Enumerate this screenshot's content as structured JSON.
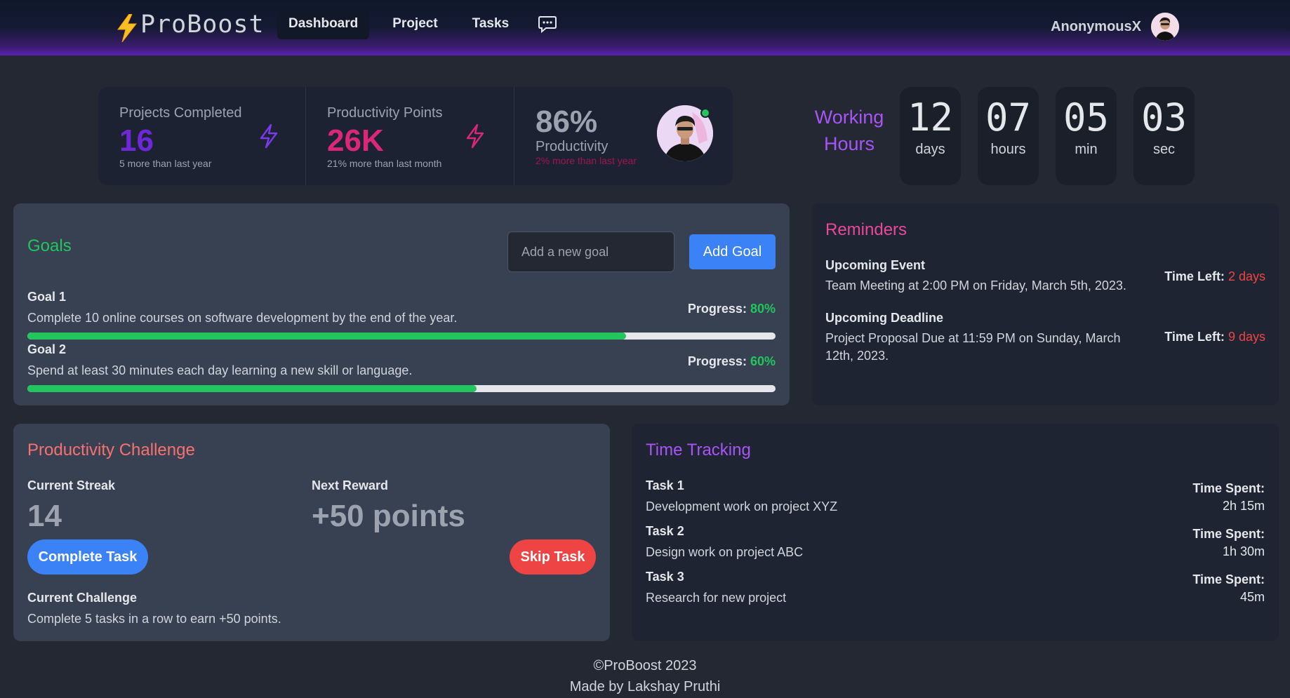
{
  "brand": {
    "name": "ProBoost"
  },
  "nav": {
    "items": [
      {
        "label": "Dashboard",
        "active": true
      },
      {
        "label": "Project",
        "active": false
      },
      {
        "label": "Tasks",
        "active": false
      }
    ],
    "chat_icon": "chat-bubble-icon"
  },
  "user": {
    "name": "AnonymousX"
  },
  "stats": [
    {
      "title": "Projects Completed",
      "value": "16",
      "desc": "5 more than last year",
      "color": "#7c3aed",
      "icon": "bolt-icon"
    },
    {
      "title": "Productivity Points",
      "value": "26K",
      "desc": "21% more than last month",
      "color": "#db2777",
      "icon": "bolt-icon"
    },
    {
      "title": "Productivity",
      "value": "86%",
      "desc": "2% more than last year",
      "color": "#9ca3af",
      "desc_color": "#9d174d"
    }
  ],
  "working_hours": {
    "label": "Working Hours",
    "units": [
      {
        "value": "12",
        "unit": "days"
      },
      {
        "value": "07",
        "unit": "hours"
      },
      {
        "value": "05",
        "unit": "min"
      },
      {
        "value": "03",
        "unit": "sec"
      }
    ]
  },
  "goals": {
    "title": "Goals",
    "input_placeholder": "Add a new goal",
    "add_button": "Add Goal",
    "progress_label": "Progress:",
    "items": [
      {
        "name": "Goal 1",
        "desc": "Complete 10 online courses on software development by the end of the year.",
        "progress": "80%",
        "progress_value": 0.8
      },
      {
        "name": "Goal 2",
        "desc": "Spend at least 30 minutes each day learning a new skill or language.",
        "progress": "60%",
        "progress_value": 0.6
      }
    ]
  },
  "reminders": {
    "title": "Reminders",
    "time_left_label": "Time Left:",
    "items": [
      {
        "heading": "Upcoming Event",
        "text": "Team Meeting at 2:00 PM on Friday, March 5th, 2023.",
        "time_left": "2 days"
      },
      {
        "heading": "Upcoming Deadline",
        "text": "Project Proposal Due at 11:59 PM on Sunday, March 12th, 2023.",
        "time_left": "9 days"
      }
    ]
  },
  "challenge": {
    "title": "Productivity Challenge",
    "streak_label": "Current Streak",
    "streak_value": "14",
    "reward_label": "Next Reward",
    "reward_value": "+50 points",
    "complete_button": "Complete Task",
    "skip_button": "Skip Task",
    "current_label": "Current Challenge",
    "current_desc": "Complete 5 tasks in a row to earn +50 points."
  },
  "tracking": {
    "title": "Time Tracking",
    "spent_label": "Time Spent:",
    "items": [
      {
        "name": "Task 1",
        "desc": "Development work on project XYZ",
        "spent": "2h 15m"
      },
      {
        "name": "Task 2",
        "desc": "Design work on project ABC",
        "spent": "1h 30m"
      },
      {
        "name": "Task 3",
        "desc": "Research for new project",
        "spent": "45m"
      }
    ]
  },
  "footer": {
    "copyright": "©ProBoost 2023",
    "credit": "Made by Lakshay Pruthi"
  },
  "colors": {
    "goals_title": "#22c55e",
    "reminders_title": "#ec4899",
    "challenge_title": "#f87171",
    "tracking_title": "#a855f7",
    "accent_blue": "#3b82f6",
    "accent_red": "#ef4444",
    "progress_green": "#22c55e"
  }
}
